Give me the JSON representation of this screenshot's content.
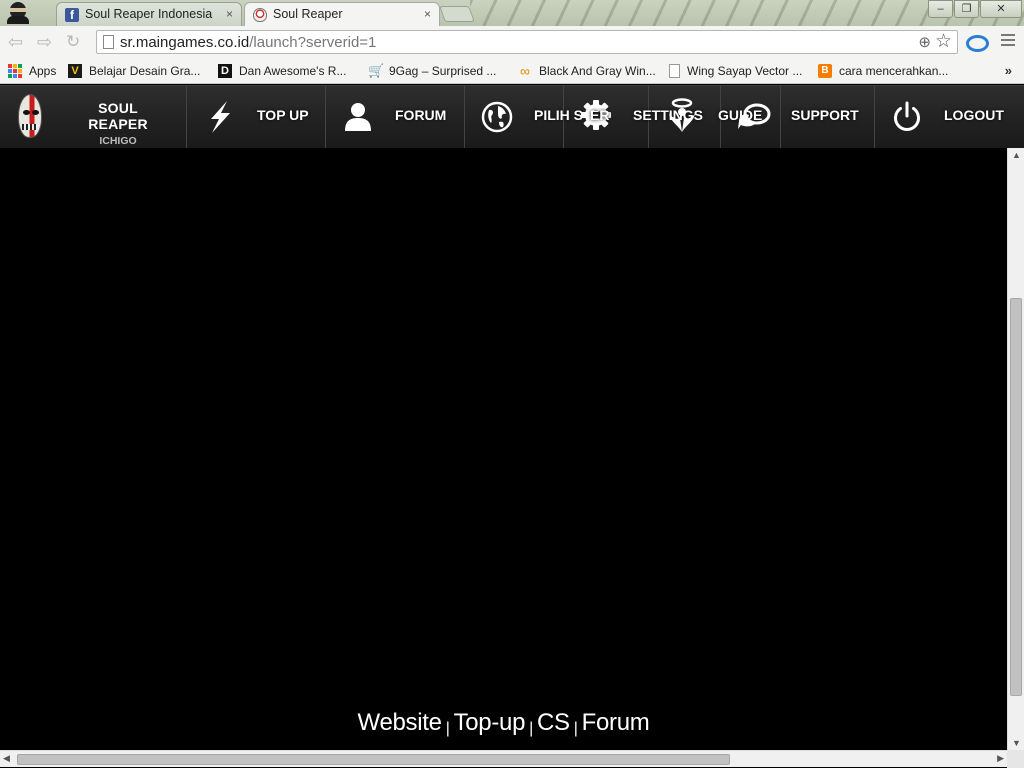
{
  "browser": {
    "tabs": [
      {
        "title": "Soul Reaper Indonesia",
        "favicon": "facebook-icon",
        "active": false
      },
      {
        "title": "Soul Reaper",
        "favicon": "soul-reaper-mask-icon",
        "active": true
      }
    ],
    "close_glyph": "×",
    "window_controls": {
      "minimize": "–",
      "restore": "❐",
      "close": "✕"
    },
    "url_host": "sr.maingames.co.id",
    "url_path": "/launch?serverid=1"
  },
  "bookmarks": {
    "items": [
      {
        "label": "Apps",
        "icon": "apps-grid-icon"
      },
      {
        "label": "Belajar Desain Gra...",
        "icon": "v-logo-icon"
      },
      {
        "label": "Dan Awesome's R...",
        "icon": "dan-logo-icon"
      },
      {
        "label": "9Gag – Surprised ...",
        "icon": "cart-icon"
      },
      {
        "label": "Black And Gray Win...",
        "icon": "link-icon"
      },
      {
        "label": "Wing Sayap Vector ...",
        "icon": "page-icon"
      },
      {
        "label": "cara mencerahkan...",
        "icon": "blogger-icon"
      }
    ],
    "overflow": "»"
  },
  "game_nav": {
    "brand_title": "SOUL REAPER",
    "brand_subtitle": "ICHIGO",
    "items": [
      {
        "label": "TOP UP",
        "icon": "lightning-bolt-icon"
      },
      {
        "label": "FORUM",
        "icon": "user-silhouette-icon"
      },
      {
        "label": "PILIH SERVER",
        "icon": "globe-icon"
      },
      {
        "label": "SETTINGS",
        "icon": "gear-icon"
      },
      {
        "label": "GUIDE",
        "icon": "angel-halo-icon"
      },
      {
        "label": "",
        "icon": "chat-bubbles-icon"
      },
      {
        "label": "SUPPORT",
        "icon": ""
      },
      {
        "label": "LOGOUT",
        "icon": "power-icon"
      }
    ],
    "pilih_visible": "PILIH S",
    "server_tail": "ER",
    "settings_visible": "SETTINGS",
    "guide_visible": "GUIDE"
  },
  "footer_links": [
    "Website",
    "Top-up",
    "CS",
    "Forum"
  ],
  "footer_separator": "|",
  "colors": {
    "nav_bg": "#262626",
    "game_bg": "#000000",
    "text": "#ffffff"
  }
}
